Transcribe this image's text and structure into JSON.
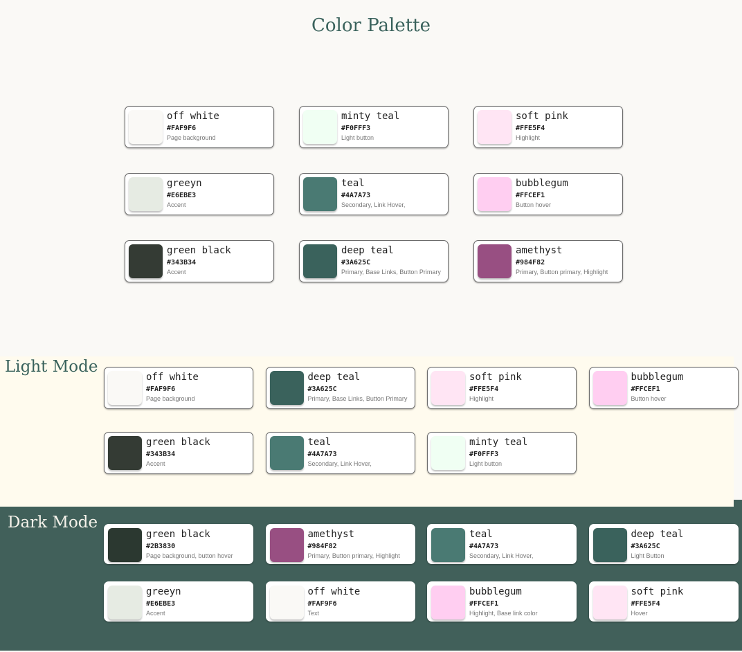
{
  "title": "Color Palette",
  "palette": [
    {
      "name": "off white",
      "hex": "#FAF9F6",
      "use": "Page background"
    },
    {
      "name": "minty teal",
      "hex": "#F0FFF3",
      "use": "Light button"
    },
    {
      "name": "soft pink",
      "hex": "#FFE5F4",
      "use": "Highlight"
    },
    {
      "name": "greeyn",
      "hex": "#E6EBE3",
      "use": "Accent"
    },
    {
      "name": "teal",
      "hex": "#4A7A73",
      "use": "Secondary, Link Hover,"
    },
    {
      "name": "bubblegum",
      "hex": "#FFCEF1",
      "use": "Button hover"
    },
    {
      "name": "green black",
      "hex": "#343B34",
      "use": "Accent"
    },
    {
      "name": "deep teal",
      "hex": "#3A625C",
      "use": "Primary, Base Links, Button Primary"
    },
    {
      "name": "amethyst",
      "hex": "#984F82",
      "use": "Primary, Button primary, Highlight"
    }
  ],
  "light_mode": {
    "label": "Light Mode",
    "colors": [
      {
        "name": "off white",
        "hex": "#FAF9F6",
        "use": "Page background"
      },
      {
        "name": "deep teal",
        "hex": "#3A625C",
        "use": "Primary, Base Links, Button Primary"
      },
      {
        "name": "soft pink",
        "hex": "#FFE5F4",
        "use": "Highlight"
      },
      {
        "name": "bubblegum",
        "hex": "#FFCEF1",
        "use": "Button hover"
      },
      {
        "name": "green black",
        "hex": "#343B34",
        "use": "Accent"
      },
      {
        "name": "teal",
        "hex": "#4A7A73",
        "use": "Secondary, Link Hover,"
      },
      {
        "name": "minty teal",
        "hex": "#F0FFF3",
        "use": "Light button"
      }
    ]
  },
  "dark_mode": {
    "label": "Dark Mode",
    "colors": [
      {
        "name": "green black",
        "hex": "#2B3830",
        "use": "Page background, button hover"
      },
      {
        "name": "amethyst",
        "hex": "#984F82",
        "use": "Primary, Button primary, Highlight"
      },
      {
        "name": "teal",
        "hex": "#4A7A73",
        "use": "Secondary, Link Hover,"
      },
      {
        "name": "deep teal",
        "hex": "#3A625C",
        "use": "Light Button"
      },
      {
        "name": "greeyn",
        "hex": "#E6EBE3",
        "use": "Accent"
      },
      {
        "name": "off white",
        "hex": "#FAF9F6",
        "use": "Text"
      },
      {
        "name": "bubblegum",
        "hex": "#FFCEF1",
        "use": "Highlight, Base link color"
      },
      {
        "name": "soft pink",
        "hex": "#FFE5F4",
        "use": "Hover"
      }
    ]
  }
}
